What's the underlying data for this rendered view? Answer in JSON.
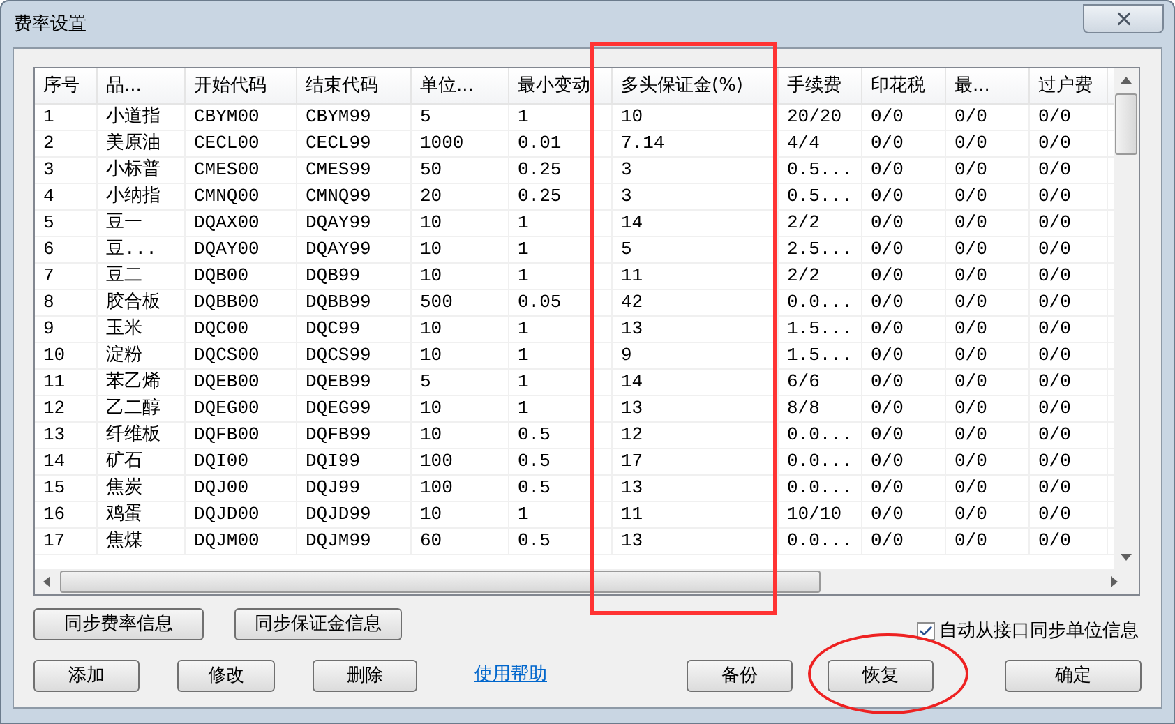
{
  "window": {
    "title": "费率设置"
  },
  "table": {
    "columns": [
      "序号",
      "品...",
      "开始代码",
      "结束代码",
      "单位...",
      "最小变动",
      "多头保证金(%)",
      "手续费",
      "印花税",
      "最...",
      "过户费"
    ],
    "rows": [
      [
        "1",
        "小道指",
        "CBYM00",
        "CBYM99",
        "5",
        "1",
        "10",
        "20/20",
        "0/0",
        "0/0",
        "0/0"
      ],
      [
        "2",
        "美原油",
        "CECL00",
        "CECL99",
        "1000",
        "0.01",
        "7.14",
        "4/4",
        "0/0",
        "0/0",
        "0/0"
      ],
      [
        "3",
        "小标普",
        "CMES00",
        "CMES99",
        "50",
        "0.25",
        "3",
        "0.5...",
        "0/0",
        "0/0",
        "0/0"
      ],
      [
        "4",
        "小纳指",
        "CMNQ00",
        "CMNQ99",
        "20",
        "0.25",
        "3",
        "0.5...",
        "0/0",
        "0/0",
        "0/0"
      ],
      [
        "5",
        "豆一",
        "DQAX00",
        "DQAY99",
        "10",
        "1",
        "14",
        "2/2",
        "0/0",
        "0/0",
        "0/0"
      ],
      [
        "6",
        "豆...",
        "DQAY00",
        "DQAY99",
        "10",
        "1",
        "5",
        "2.5...",
        "0/0",
        "0/0",
        "0/0"
      ],
      [
        "7",
        "豆二",
        "DQB00",
        "DQB99",
        "10",
        "1",
        "11",
        "2/2",
        "0/0",
        "0/0",
        "0/0"
      ],
      [
        "8",
        "胶合板",
        "DQBB00",
        "DQBB99",
        "500",
        "0.05",
        "42",
        "0.0...",
        "0/0",
        "0/0",
        "0/0"
      ],
      [
        "9",
        "玉米",
        "DQC00",
        "DQC99",
        "10",
        "1",
        "13",
        "1.5...",
        "0/0",
        "0/0",
        "0/0"
      ],
      [
        "10",
        "淀粉",
        "DQCS00",
        "DQCS99",
        "10",
        "1",
        "9",
        "1.5...",
        "0/0",
        "0/0",
        "0/0"
      ],
      [
        "11",
        "苯乙烯",
        "DQEB00",
        "DQEB99",
        "5",
        "1",
        "14",
        "6/6",
        "0/0",
        "0/0",
        "0/0"
      ],
      [
        "12",
        "乙二醇",
        "DQEG00",
        "DQEG99",
        "10",
        "1",
        "13",
        "8/8",
        "0/0",
        "0/0",
        "0/0"
      ],
      [
        "13",
        "纤维板",
        "DQFB00",
        "DQFB99",
        "10",
        "0.5",
        "12",
        "0.0...",
        "0/0",
        "0/0",
        "0/0"
      ],
      [
        "14",
        "矿石",
        "DQI00",
        "DQI99",
        "100",
        "0.5",
        "17",
        "0.0...",
        "0/0",
        "0/0",
        "0/0"
      ],
      [
        "15",
        "焦炭",
        "DQJ00",
        "DQJ99",
        "100",
        "0.5",
        "13",
        "0.0...",
        "0/0",
        "0/0",
        "0/0"
      ],
      [
        "16",
        "鸡蛋",
        "DQJD00",
        "DQJD99",
        "10",
        "1",
        "11",
        "10/10",
        "0/0",
        "0/0",
        "0/0"
      ],
      [
        "17",
        "焦煤",
        "DQJM00",
        "DQJM99",
        "60",
        "0.5",
        "13",
        "0.0...",
        "0/0",
        "0/0",
        "0/0"
      ]
    ]
  },
  "sync_buttons": [
    "同步费率信息",
    "同步保证金信息"
  ],
  "auto_sync": {
    "label": "自动从接口同步单位信息",
    "checked": true
  },
  "edit_buttons": [
    "添加",
    "修改",
    "删除"
  ],
  "help_link": "使用帮助",
  "action_buttons": [
    "备份",
    "恢复",
    "确定"
  ]
}
